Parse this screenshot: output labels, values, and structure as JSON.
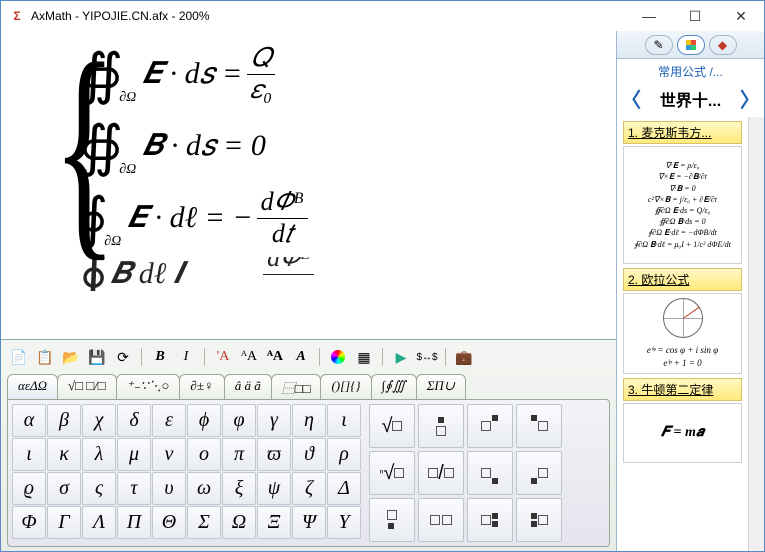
{
  "window": {
    "title": "AxMath - YIPOJIE.CN.afx - 200%"
  },
  "equations": {
    "line1": {
      "int": "∯",
      "sub": "∂Ω",
      "body": "𝑬 · d𝑠  =",
      "frac_num": "𝑄",
      "frac_den": "𝜀₀"
    },
    "line2": {
      "int": "∯",
      "sub": "∂Ω",
      "body": "𝑩 · d𝑠  = 0"
    },
    "line3": {
      "int": "∮",
      "sub": "∂Ω",
      "body": "𝑬 · dℓ  = −",
      "frac_num": "d𝛷ᴮ",
      "frac_den": "d𝑡"
    },
    "line4": {
      "int": "∮",
      "sub": "",
      "body": "𝑩   dℓ          𝑰",
      "tail": "d𝛷ᴱ"
    }
  },
  "toolbar": {
    "new": "new",
    "open": "open",
    "folder": "folder",
    "save": "save",
    "refresh": "refresh",
    "bold": "B",
    "italic": "I",
    "fa": "A",
    "fa2": "A",
    "fa3": "A",
    "fa4": "A",
    "color": "color",
    "palette": "pal",
    "run": "▶",
    "xy": "$↔$",
    "brief": "brief"
  },
  "tabs": [
    "αεΔΩ",
    "√□ □/□",
    "⁺₋∵⋱○",
    "∂±♀",
    "â ä ã",
    "⿱□□",
    "()[]{}",
    "∫∮∭",
    "ΣΠ∪"
  ],
  "active_tab": 0,
  "greek_rows": [
    [
      "α",
      "β",
      "χ",
      "δ",
      "ε",
      "ϕ",
      "φ",
      "γ",
      "η",
      "ι"
    ],
    [
      "ι",
      "κ",
      "λ",
      "μ",
      "ν",
      "ο",
      "π",
      "ϖ",
      "ϑ",
      "ρ"
    ],
    [
      "ϱ",
      "σ",
      "ς",
      "τ",
      "υ",
      "ω",
      "ξ",
      "ψ",
      "ζ",
      "Δ"
    ],
    [
      "Φ",
      "Γ",
      "Λ",
      "Π",
      "Θ",
      "Σ",
      "Ω",
      "Ξ",
      "Ψ",
      "Υ"
    ]
  ],
  "side": {
    "breadcrumb": "常用公式 /...",
    "nav_title": "世界十...",
    "items": [
      {
        "header": "1. 麦克斯韦方...",
        "preview_lines": [
          "∇·𝐄 = ρ/ε₀",
          "∇×𝐄 = −∂𝐁/∂t",
          "∇·𝐁 = 0",
          "c²∇×𝐁 = j/ε₀ + ∂𝐄/∂t",
          "∯∂Ω 𝐄·ds = Q/ε₀",
          "∯∂Ω 𝐁·ds = 0",
          "∮∂Ω 𝐄·dℓ = −dΦB/dt",
          "∮∂Ω 𝐁·dℓ = μ₀I + 1/c² dΦE/dt"
        ]
      },
      {
        "header": "2. 欧拉公式",
        "preview_lines": [
          "(unit circle diagram)",
          "eⁱᵠ = cos φ + i sin φ",
          "eⁱᵖ + 1 = 0"
        ]
      },
      {
        "header": "3. 牛顿第二定律",
        "preview_lines": [
          "𝑭 = m𝒂"
        ]
      }
    ]
  }
}
